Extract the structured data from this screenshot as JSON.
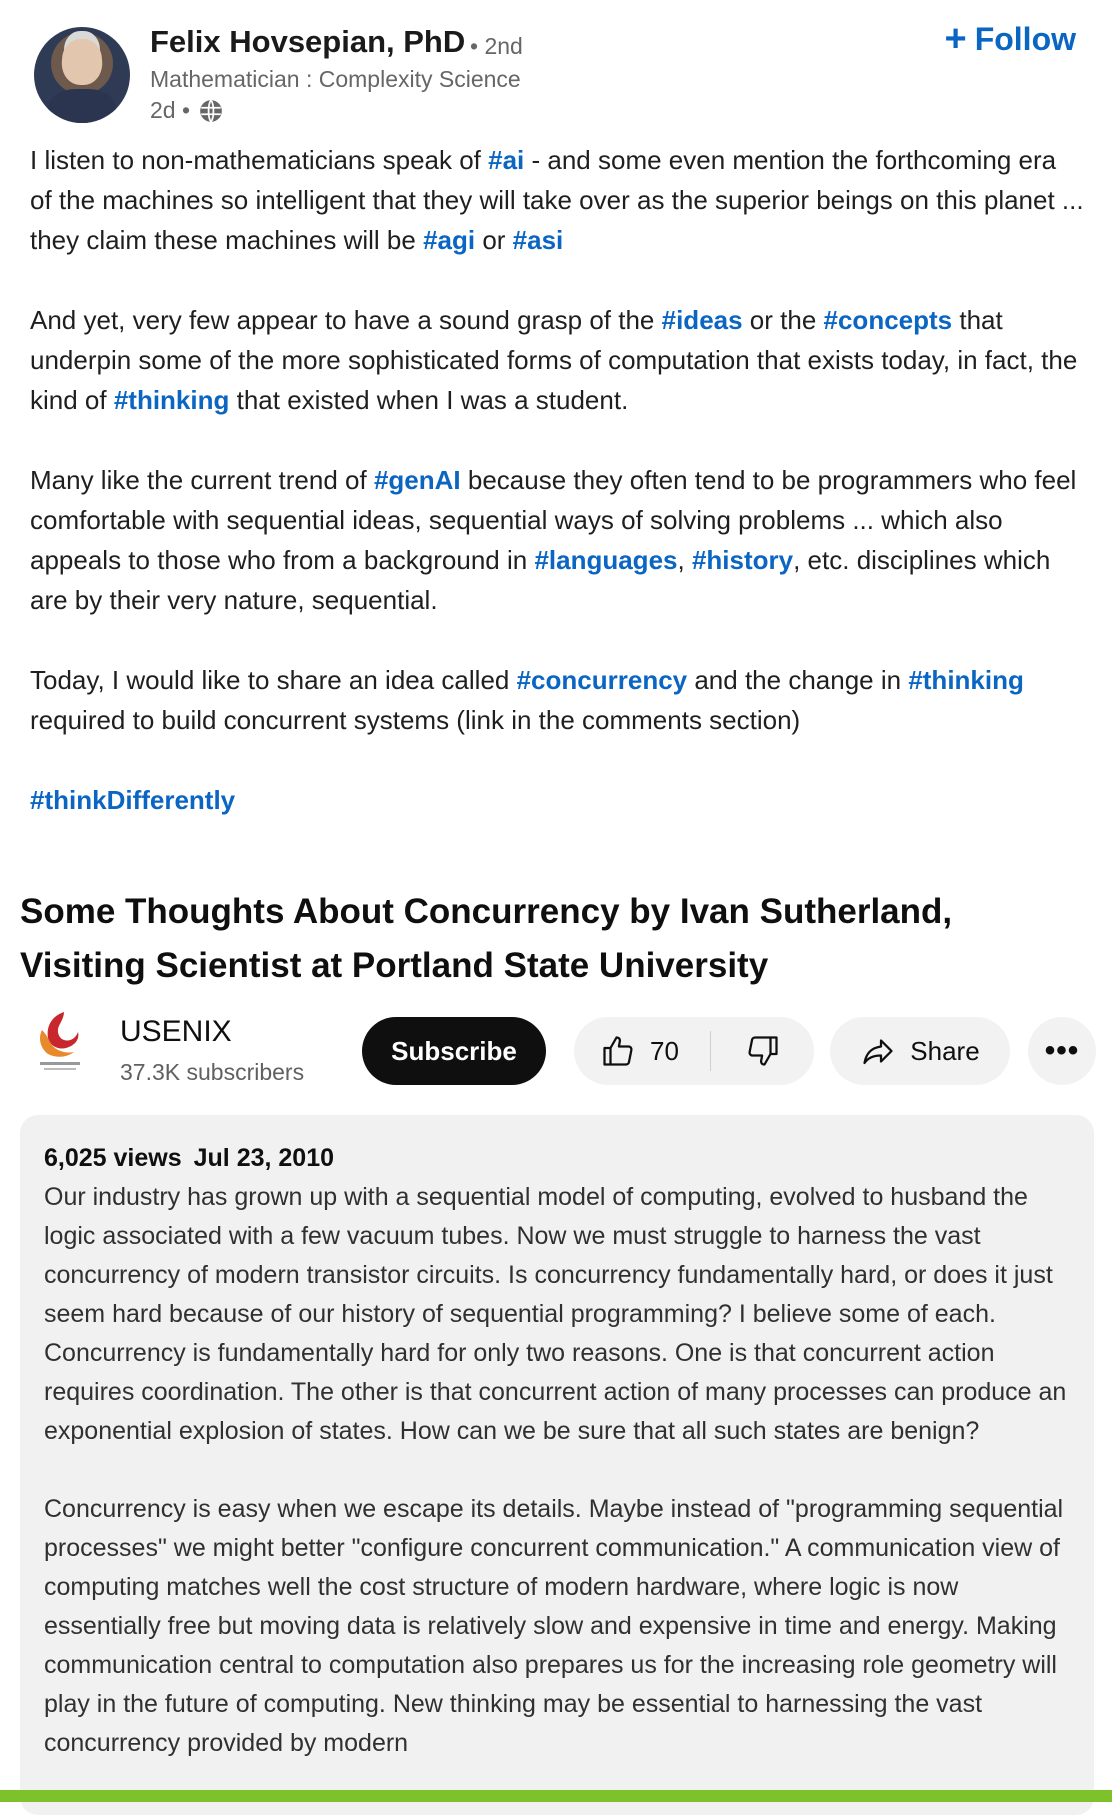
{
  "post": {
    "author_name": "Felix Hovsepian, PhD",
    "degree": "• 2nd",
    "headline": "Mathematician : Complexity Science",
    "time_ago": "2d •",
    "follow_label": "Follow",
    "paragraphs": [
      [
        {
          "text": "I listen to non-mathematicians speak of "
        },
        {
          "text": "#ai",
          "tag": true
        },
        {
          "text": " - and some even mention the forthcoming era of the machines so intelligent that they will take over as the superior beings on this planet ... they claim these machines will be "
        },
        {
          "text": "#agi",
          "tag": true
        },
        {
          "text": " or "
        },
        {
          "text": "#asi",
          "tag": true
        }
      ],
      [
        {
          "text": "And yet, very few appear to have a sound grasp of the "
        },
        {
          "text": "#ideas",
          "tag": true
        },
        {
          "text": " or the "
        },
        {
          "text": "#concepts",
          "tag": true
        },
        {
          "text": "  that underpin some of the more sophisticated forms of computation that exists today, in fact, the kind of "
        },
        {
          "text": "#thinking",
          "tag": true
        },
        {
          "text": " that existed when I was a student."
        }
      ],
      [
        {
          "text": "Many like the current trend of "
        },
        {
          "text": "#genAI",
          "tag": true
        },
        {
          "text": " because they often tend to be programmers who feel comfortable with sequential ideas, sequential ways of solving problems ... which also appeals to those who from a background in "
        },
        {
          "text": "#languages",
          "tag": true
        },
        {
          "text": ", "
        },
        {
          "text": "#history",
          "tag": true
        },
        {
          "text": ", etc. disciplines which are by their very nature, sequential."
        }
      ],
      [
        {
          "text": "Today, I would like to share an idea called "
        },
        {
          "text": "#concurrency",
          "tag": true
        },
        {
          "text": " and the change in "
        },
        {
          "text": "#thinking",
          "tag": true
        },
        {
          "text": " required to build concurrent systems (link in the comments section)"
        }
      ],
      [
        {
          "text": "#thinkDifferently",
          "tag": true
        }
      ]
    ]
  },
  "video": {
    "title": "Some Thoughts About Concurrency by Ivan Sutherland, Visiting Scientist at Portland State University",
    "channel_name": "USENIX",
    "subscribers": "37.3K subscribers",
    "subscribe_label": "Subscribe",
    "like_count": "70",
    "share_label": "Share",
    "more_label": "•••",
    "views": "6,025 views",
    "date": "Jul 23, 2010",
    "description": [
      "Our industry has grown up with a sequential model of computing, evolved to husband the logic associated with a few vacuum tubes. Now we must struggle to harness the vast concurrency of modern transistor circuits. Is concurrency fundamentally hard, or does it just seem hard because of our history of sequential programming? I believe some of each. Concurrency is fundamentally hard for only two reasons. One is that concurrent action requires coordination. The other is that concurrent action of many processes can produce an exponential explosion of states. How can we be sure that all such states are benign?",
      "Concurrency is easy when we escape its details. Maybe instead of \"programming sequential processes\" we might better \"configure concurrent communication.\" A communication view of computing matches well the cost structure of modern hardware, where logic is now essentially free but moving data is relatively slow and expensive in time and energy. Making communication central to computation also prepares us for the increasing role geometry will play in the future of computing. New thinking may be essential to harnessing the vast concurrency provided by modern"
    ]
  },
  "colors": {
    "link": "#0a66c2",
    "accent_bar": "#7dc12b",
    "subscribe_bg": "#0f0f0f",
    "pill_bg": "#f2f2f2"
  },
  "icons": {
    "globe": "globe-icon",
    "plus": "plus-icon",
    "thumbs_up": "thumbs-up-icon",
    "thumbs_down": "thumbs-down-icon",
    "share": "share-arrow-icon",
    "more": "more-options-icon"
  }
}
